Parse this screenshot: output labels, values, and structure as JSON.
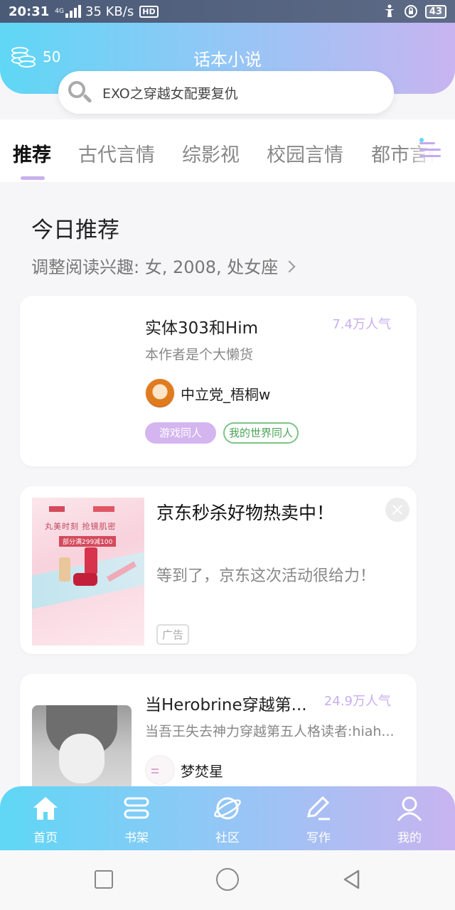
{
  "status_bar": {
    "time": "20:31",
    "network_type": "4G",
    "speed": "35 KB/s",
    "hd": "HD",
    "battery": "43"
  },
  "header": {
    "coins": "50",
    "title": "话本小说",
    "search_placeholder": "EXO之穿越女配要复仇"
  },
  "tabs": [
    {
      "label": "推荐",
      "active": true
    },
    {
      "label": "古代言情"
    },
    {
      "label": "综影视"
    },
    {
      "label": "校园言情"
    },
    {
      "label": "都市言情"
    }
  ],
  "section": {
    "title": "今日推荐",
    "interest": "调整阅读兴趣: 女, 2008, 处女座"
  },
  "books": [
    {
      "title": "实体303和Him",
      "popularity": "7.4万人气",
      "description": "本作者是个大懒货",
      "author": "中立党_梧桐w",
      "tags": [
        "游戏同人",
        "我的世界同人"
      ]
    },
    {
      "title": "当Herobrine穿越第...",
      "popularity": "24.9万人气",
      "description": "当吾王失去神力穿越第五人格读者:hiah...",
      "author": "梦焚星"
    }
  ],
  "ad": {
    "title": "京东秒杀好物热卖中！",
    "subtitle": "等到了，京东这次活动很给力！",
    "badge": "广告",
    "image_text": "丸美时刻 抢镜肌密",
    "image_offer": "部分满299减100"
  },
  "bottom_nav": [
    {
      "label": "首页",
      "icon": "home-icon"
    },
    {
      "label": "书架",
      "icon": "bookshelf-icon"
    },
    {
      "label": "社区",
      "icon": "planet-icon"
    },
    {
      "label": "写作",
      "icon": "pen-icon"
    },
    {
      "label": "我的",
      "icon": "user-icon"
    }
  ],
  "colors": {
    "gradient_start": "#5fd7f5",
    "gradient_end": "#c8b4f0",
    "accent_purple": "#c8aeef",
    "tag_green": "#4aa456"
  }
}
